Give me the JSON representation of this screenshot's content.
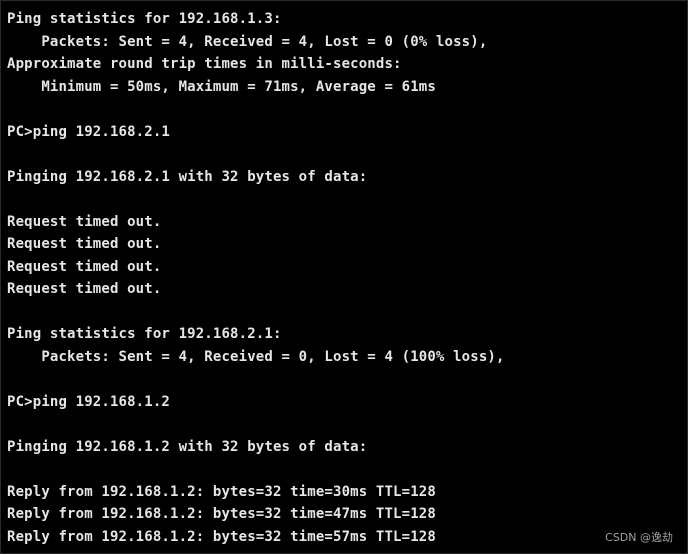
{
  "terminal": {
    "lines": [
      "Ping statistics for 192.168.1.3:",
      "    Packets: Sent = 4, Received = 4, Lost = 0 (0% loss),",
      "Approximate round trip times in milli-seconds:",
      "    Minimum = 50ms, Maximum = 71ms, Average = 61ms",
      "",
      "PC>ping 192.168.2.1",
      "",
      "Pinging 192.168.2.1 with 32 bytes of data:",
      "",
      "Request timed out.",
      "Request timed out.",
      "Request timed out.",
      "Request timed out.",
      "",
      "Ping statistics for 192.168.2.1:",
      "    Packets: Sent = 4, Received = 0, Lost = 4 (100% loss),",
      "",
      "PC>ping 192.168.1.2",
      "",
      "Pinging 192.168.1.2 with 32 bytes of data:",
      "",
      "Reply from 192.168.1.2: bytes=32 time=30ms TTL=128",
      "Reply from 192.168.1.2: bytes=32 time=47ms TTL=128",
      "Reply from 192.168.1.2: bytes=32 time=57ms TTL=128"
    ]
  },
  "watermark": "CSDN @逸劫",
  "colors": {
    "background": "#000000",
    "text": "#e6e6e6"
  }
}
